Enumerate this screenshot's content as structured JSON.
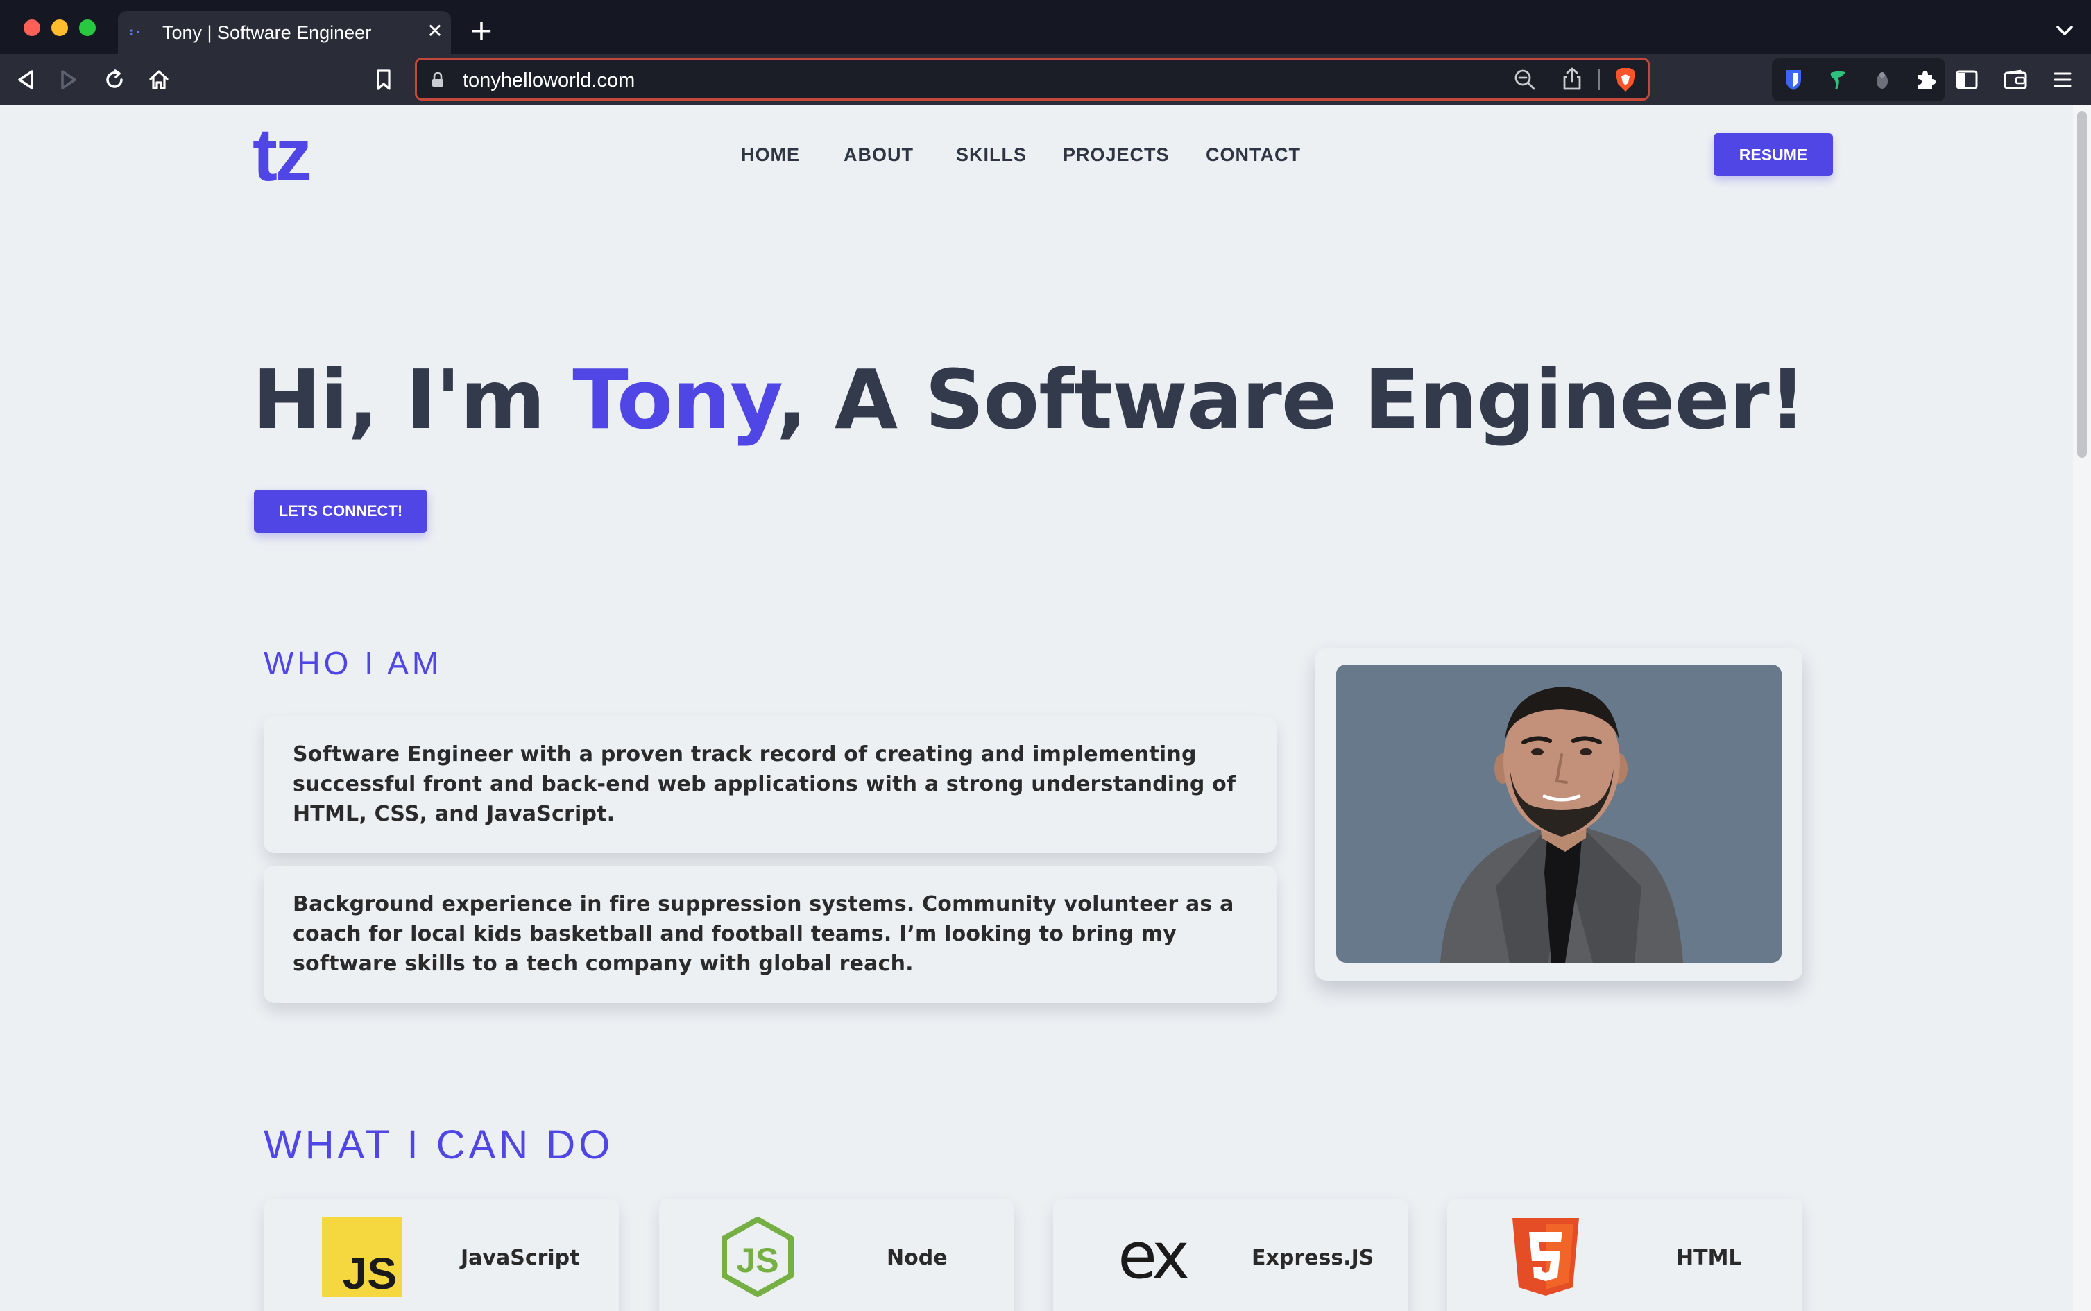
{
  "browser": {
    "tab_title": "Tony | Software Engineer",
    "url": "tonyhelloworld.com"
  },
  "site": {
    "logo": "tz",
    "nav": [
      "HOME",
      "ABOUT",
      "SKILLS",
      "PROJECTS",
      "CONTACT"
    ],
    "resume_button": "RESUME"
  },
  "hero": {
    "prefix": "Hi, I'm ",
    "name": "Tony",
    "suffix": ", A Software Engineer!",
    "cta": "LETS CONNECT!"
  },
  "about": {
    "title": "WHO I AM",
    "paragraphs": [
      "Software Engineer with a proven track record of creating and implementing successful front and back-end web applications with a strong understanding of HTML, CSS, and JavaScript.",
      "Background experience in fire suppression systems. Community volunteer as a coach for local kids basketball and football teams. I’m looking to bring my software skills to a tech company with global reach."
    ]
  },
  "skills": {
    "title": "WHAT I CAN DO",
    "items": [
      {
        "label": "JavaScript",
        "icon": "javascript-icon"
      },
      {
        "label": "Node",
        "icon": "nodejs-icon"
      },
      {
        "label": "Express.JS",
        "icon": "express-icon"
      },
      {
        "label": "HTML",
        "icon": "html5-icon"
      }
    ]
  },
  "colors": {
    "accent": "#4f46e5",
    "heading": "#323a4c",
    "page_background": "#edf0f3",
    "chrome_dark": "#151823",
    "url_border": "#c4493a"
  }
}
